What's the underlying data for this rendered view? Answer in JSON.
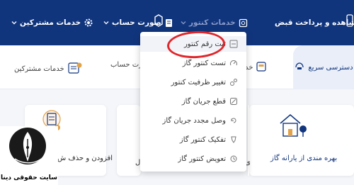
{
  "navbar": {
    "items": [
      {
        "label": "مشاهده و پرداخت قبض",
        "icon": "bill-receipt-icon"
      },
      {
        "label": "خدمات کنتور",
        "icon": "meter-icon"
      },
      {
        "label": "صورت حساب",
        "icon": "invoice-icon"
      },
      {
        "label": "خدمات مشترکین",
        "icon": "gear-icon"
      }
    ],
    "colors": {
      "background": "#11357d",
      "text": "#ffffff",
      "dimmed_text": "#8a9bc7"
    }
  },
  "subbar": {
    "quick_access_label": "دسترسی سریع",
    "items": [
      {
        "label": "خد",
        "icon": "meter-tab-icon"
      },
      {
        "label": "ورت حساب",
        "icon": "invoice-tab-icon"
      },
      {
        "label": "خدمات مشترکین",
        "icon": "subscriber-services-icon"
      }
    ]
  },
  "dropdown": {
    "items": [
      {
        "label": "ثبت رقم کنتور",
        "icon": "meter-reading-icon",
        "active": true
      },
      {
        "label": "تست کنتور گاز",
        "icon": "gauge-test-icon"
      },
      {
        "label": "تغییر ظرفیت کنتور",
        "icon": "capacity-icon"
      },
      {
        "label": "قطع جریان گاز",
        "icon": "cut-off-icon"
      },
      {
        "label": "وصل مجدد جریان گاز",
        "icon": "reconnect-icon"
      },
      {
        "label": "تفکیک کنتور گاز",
        "icon": "split-meter-icon"
      },
      {
        "label": "تعویض کنتور گاز",
        "icon": "replace-meter-icon"
      }
    ]
  },
  "cards": [
    {
      "label": "بهره مندی از یارانه گاز",
      "icon": "village-house-icon"
    },
    {
      "label": "افزودن و حذف ش",
      "icon": "document-stamp-icon"
    },
    {
      "label": "ل",
      "icon": ""
    },
    {
      "label": "ی",
      "icon": ""
    }
  ],
  "watermark": {
    "text": "سایت حقوقی دینا",
    "icon": "pen-nib-logo-icon"
  },
  "accent": {
    "highlight": "#e0262b",
    "brand": "#11357d"
  }
}
